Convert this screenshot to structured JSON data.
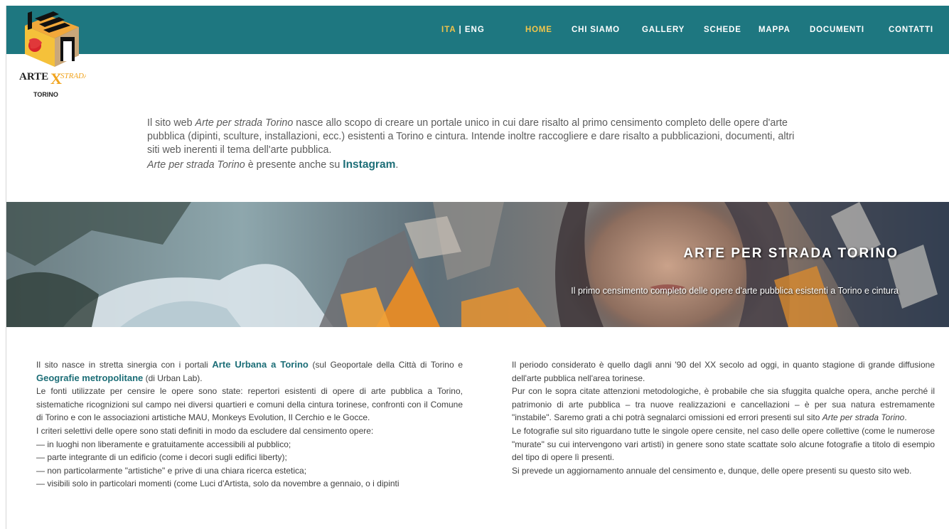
{
  "header": {
    "logo": {
      "text_top": "ARTE",
      "text_cross": "X",
      "text_strada": "STRADA",
      "text_city": "TORINO"
    },
    "lang": {
      "ita": "ITA",
      "sep": " | ",
      "eng": "ENG"
    },
    "nav": [
      {
        "label": "HOME",
        "active": true
      },
      {
        "label": "CHI SIAMO"
      },
      {
        "label": "GALLERY"
      },
      {
        "label": "SCHEDE"
      },
      {
        "label": "MAPPA"
      },
      {
        "label": "DOCUMENTI"
      },
      {
        "label": "CONTATTI"
      }
    ]
  },
  "intro": {
    "p1_a": "Il sito web ",
    "p1_em": "Arte per strada Torino",
    "p1_b": " nasce allo scopo di creare un portale unico in cui dare risalto al primo censimento completo delle opere d'arte pubblica (dipinti, sculture, installazioni, ecc.) esistenti a Torino e cintura. Intende inoltre raccogliere e dare risalto a pubblicazioni, documenti, altri siti web inerenti il tema dell'arte pubblica.",
    "p2_em": "Arte per strada Torino",
    "p2_a": " è presente anche su ",
    "p2_link": "Instagram",
    "p2_b": "."
  },
  "banner": {
    "title": "ARTE PER STRADA TORINO",
    "subtitle": "Il primo censimento completo delle opere d'arte pubblica esistenti a Torino e cintura"
  },
  "left": {
    "p1_a": "Il sito nasce in stretta sinergia con i portali ",
    "p1_link1": "Arte Urbana a Torino",
    "p1_b": " (sul Geoportale della Città di Torino e ",
    "p1_link2": "Geografie metropolitane",
    "p1_c": " (di Urban Lab).",
    "p2": "Le fonti utilizzate per censire le opere sono state: repertori esistenti di opere di arte pubblica a Torino, sistematiche ricognizioni sul campo nei diversi quartieri e comuni della cintura torinese, confronti con il Comune di Torino e con le associazioni artistiche MAU, Monkeys Evolution, Il Cerchio e le Gocce.",
    "p3": "I criteri selettivi delle opere sono stati definiti in modo da escludere dal censimento opere:",
    "items": [
      "— in luoghi non liberamente e gratuitamente accessibili al pubblico;",
      "— parte integrante di un edificio (come i decori sugli edifici liberty);",
      "— non particolarmente \"artistiche\" e prive di una chiara ricerca estetica;",
      "— visibili solo in particolari momenti (come Luci d'Artista, solo da novembre a gennaio, o i dipinti"
    ]
  },
  "right": {
    "p1": "Il periodo considerato è quello dagli anni '90 del XX secolo ad oggi, in quanto stagione di grande diffusione dell'arte pubblica nell'area torinese.",
    "p2_a": "Pur con le sopra citate attenzioni metodologiche, è probabile che sia sfuggita qualche opera, anche perché il patrimonio di arte pubblica – tra nuove realizzazioni e cancellazioni – è per sua natura estremamente \"instabile\". Saremo grati a chi potrà segnalarci omissioni ed errori presenti sul sito ",
    "p2_em": "Arte per strada Torino",
    "p2_b": ".",
    "p3": "Le fotografie sul sito riguardano tutte le singole opere censite, nel caso delle opere collettive (come le numerose \"murate\" su cui intervengono vari artisti) in genere sono state scattate solo alcune fotografie a titolo di esempio del tipo di opere lì presenti.",
    "p4": "Si prevede un aggiornamento annuale del censimento e, dunque, delle opere presenti su questo sito web."
  },
  "colors": {
    "header_bg": "#1e7780",
    "nav_active": "#f2c64b",
    "link": "#1c6e77"
  }
}
